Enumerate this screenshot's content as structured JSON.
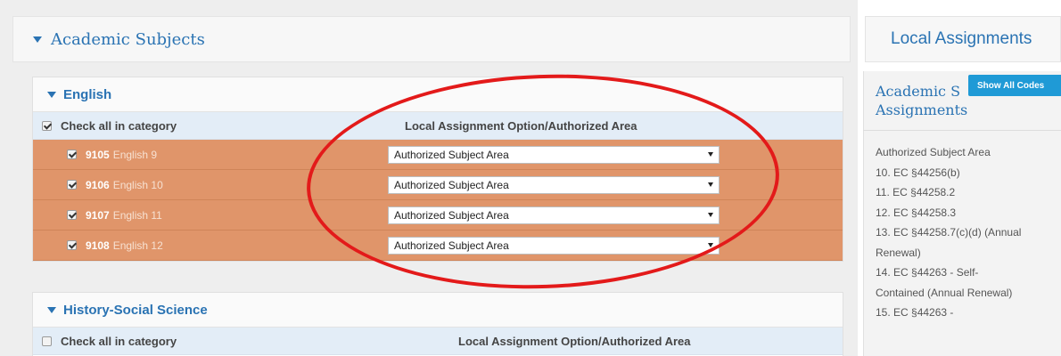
{
  "main": {
    "title": "Academic Subjects"
  },
  "english": {
    "title": "English",
    "check_all_label": "Check all in category",
    "option_header": "Local Assignment Option/Authorized Area",
    "rows": [
      {
        "code": "9105",
        "name": "English 9",
        "selected": "Authorized Subject Area"
      },
      {
        "code": "9106",
        "name": "English 10",
        "selected": "Authorized Subject Area"
      },
      {
        "code": "9107",
        "name": "English 11",
        "selected": "Authorized Subject Area"
      },
      {
        "code": "9108",
        "name": "English 12",
        "selected": "Authorized Subject Area"
      }
    ]
  },
  "history": {
    "title": "History-Social Science",
    "check_all_label": "Check all in category",
    "option_header": "Local Assignment Option/Authorized Area"
  },
  "right": {
    "header": "Local Assignments",
    "panel_title_line1": "Academic S",
    "panel_title_line2": "Assignments",
    "show_all_label": "Show All Codes",
    "items": [
      "Authorized Subject Area",
      "10. EC §44256(b)",
      "11. EC §44258.2",
      "12. EC §44258.3",
      "13. EC §44258.7(c)(d) (Annual",
      "Renewal)",
      "14. EC §44263 - Self-",
      "Contained (Annual Renewal)",
      "15. EC §44263 -"
    ]
  },
  "colors": {
    "accent": "#2a73b3",
    "row_bg": "#e0956a",
    "highlight": "#e31a1a",
    "button": "#1f9ad6"
  }
}
